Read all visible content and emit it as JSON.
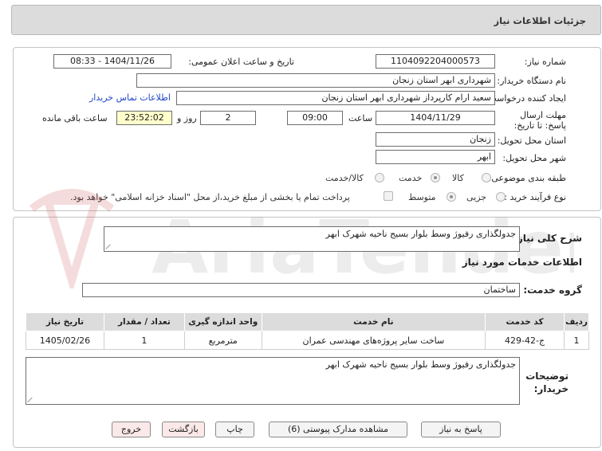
{
  "header": {
    "title": "جزئیات اطلاعات نیاز"
  },
  "form": {
    "need_number_label": "شماره نیاز:",
    "need_number": "1104092204000573",
    "announce_label": "تاریخ و ساعت اعلان عمومی:",
    "announce_value": "1404/11/26 - 08:33",
    "buyer_org_label": "نام دستگاه خریدار:",
    "buyer_org": "شهرداری ابهر استان زنجان",
    "creator_label": "ایجاد کننده درخواست:",
    "creator": "سعید ارام کارپرداز  شهرداری ابهر استان زنجان",
    "contact_link": "اطلاعات تماس خریدار",
    "deadline_label": "مهلت ارسال پاسخ: تا تاریخ:",
    "deadline_date": "1404/11/29",
    "time_label": "ساعت",
    "deadline_time": "09:00",
    "days_value": "2",
    "days_label": "روز و",
    "remaining_time": "23:52:02",
    "remaining_label": "ساعت باقی مانده",
    "province_label": "استان محل تحویل:",
    "province": "زنجان",
    "city_label": "شهر محل تحویل:",
    "city": "ابهر",
    "category_label": "طبقه بندی موضوعی:",
    "category_options": [
      "کالا",
      "خدمت",
      "کالا/خدمت"
    ],
    "process_label": "نوع فرآیند خرید :",
    "process_options": [
      "جزیی",
      "متوسط"
    ],
    "payment_note": "پرداخت تمام یا بخشی از مبلغ خرید،از محل \"اسناد خزانه اسلامی\" خواهد بود."
  },
  "details": {
    "general_desc_label": "شرح کلی نیاز:",
    "general_desc": "جدولگذاری رفیوژ وسط بلوار بسیج ناحیه شهرک ابهر",
    "services_title": "اطلاعات خدمات مورد نیاز",
    "service_group_label": "گروه خدمت:",
    "service_group": "ساختمان",
    "table": {
      "headers": [
        "ردیف",
        "کد خدمت",
        "نام خدمت",
        "واحد اندازه گیری",
        "تعداد / مقدار",
        "تاریخ نیاز"
      ],
      "rows": [
        [
          "1",
          "ج-42-429",
          "ساخت سایر پروژه‌های مهندسی عمران",
          "مترمربع",
          "1",
          "1405/02/26"
        ]
      ]
    },
    "buyer_notes_label": "توضیحات خریدار:",
    "buyer_notes": "جدولگذاری رفیوژ وسط بلوار بسیج ناحیه شهرک ابهر"
  },
  "buttons": {
    "reply": "پاسخ به نیاز",
    "view_docs": "مشاهده مدارک پیوستی (6)",
    "print": "چاپ",
    "back": "بازگشت",
    "exit": "خروج"
  }
}
